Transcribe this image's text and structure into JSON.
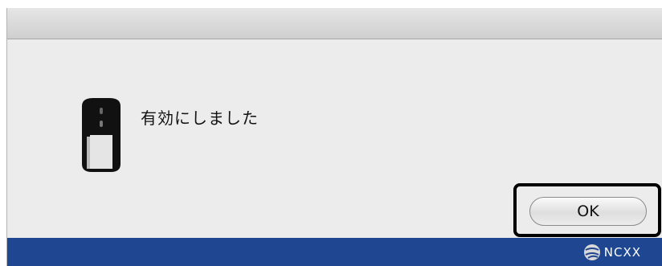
{
  "dialog": {
    "message": "有効にしました",
    "ok_label": "OK"
  },
  "app_icon": "mouse-icon",
  "footer": {
    "brand_name": "NCXX",
    "color": "#1f4690"
  }
}
